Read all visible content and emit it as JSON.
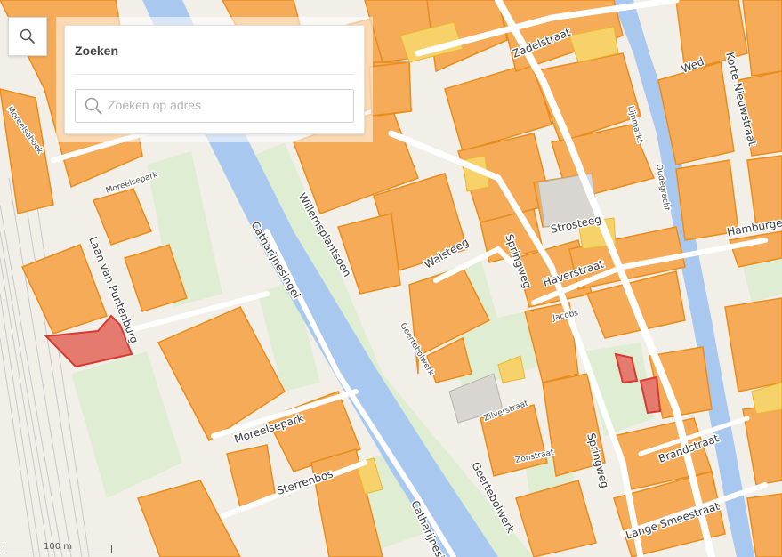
{
  "panel": {
    "title": "Zoeken",
    "search_placeholder": "Zoeken op adres",
    "search_value": ""
  },
  "scale_bar": {
    "label": "100 m"
  },
  "colors": {
    "background": "#f2efe9",
    "water": "#a9c8ef",
    "green": "#dfeed3",
    "building_orange": "#f5ab57",
    "building_yellow": "#f7d26b",
    "building_red": "#e57a6e",
    "building_outline": "#e88d1d",
    "red_outline": "#d93a2f"
  },
  "icons": {
    "search": "search-icon"
  },
  "street_labels": [
    "Zadelstraat",
    "Wed",
    "Korte Nieuwstraat",
    "Lijnmarkt",
    "Oudegracht",
    "Moreelsepark",
    "Moreelsehoek",
    "Laan van Puntenburg",
    "Catharijnesingel",
    "Willemsplantsoen",
    "Walsteeg",
    "Springweg",
    "Strosteeg",
    "Haverstraat",
    "Hamburger",
    "Geertebolwerk",
    "Moreelsepark",
    "Sterrenbos",
    "Zilverstraat",
    "Lange Smeestraat",
    "Brandstraat",
    "Catharijnesin",
    "Jacobs",
    "Zonstraat",
    "Springweg",
    "Geertebolwerk"
  ]
}
